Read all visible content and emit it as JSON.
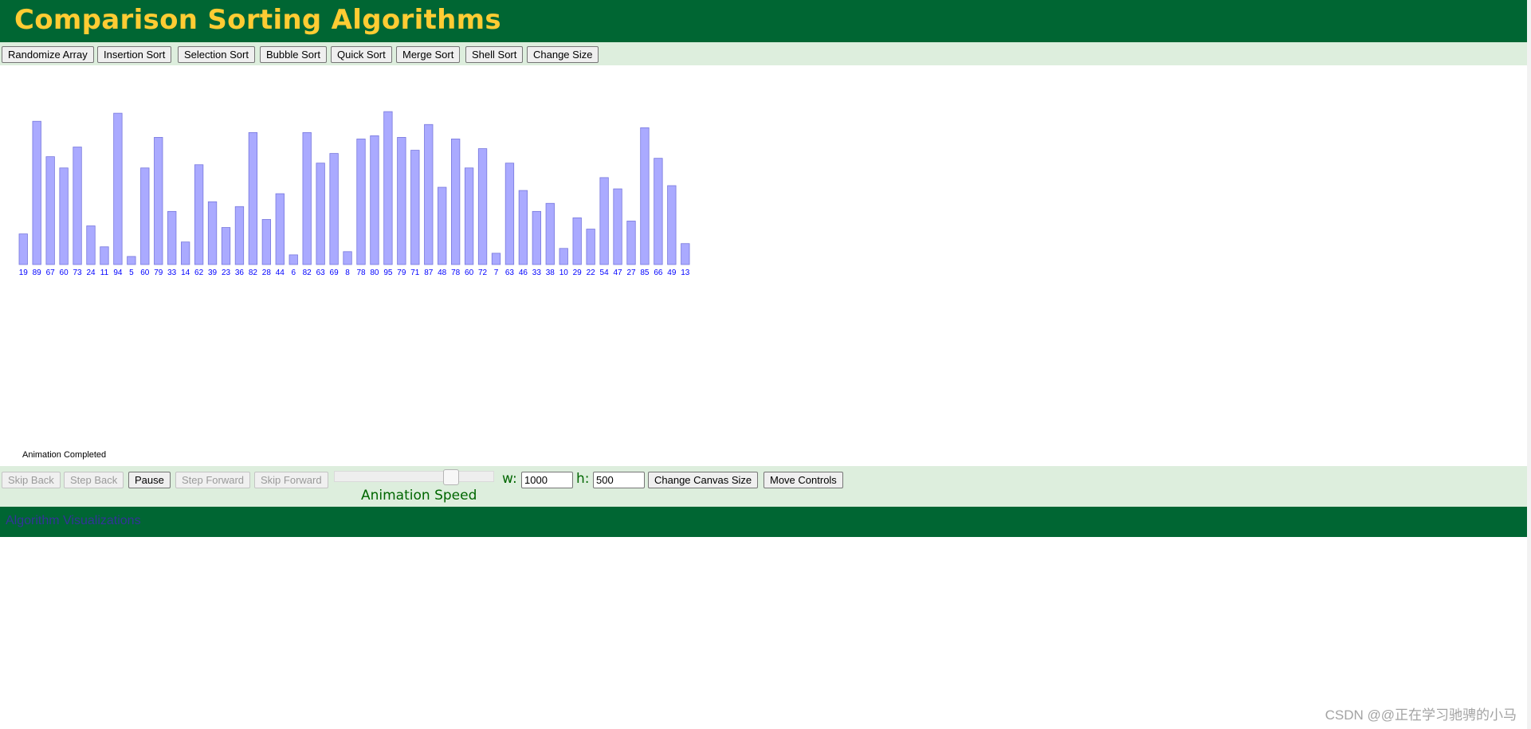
{
  "header": {
    "title": "Comparison Sorting Algorithms"
  },
  "top_controls": {
    "buttons": [
      "Randomize Array",
      "Insertion Sort",
      "Selection Sort",
      "Bubble Sort",
      "Quick Sort",
      "Merge Sort",
      "Shell Sort",
      "Change Size"
    ]
  },
  "chart_data": {
    "type": "bar",
    "values": [
      19,
      89,
      67,
      60,
      73,
      24,
      11,
      94,
      5,
      60,
      79,
      33,
      14,
      62,
      39,
      23,
      36,
      82,
      28,
      44,
      6,
      82,
      63,
      69,
      8,
      78,
      80,
      95,
      79,
      71,
      87,
      48,
      78,
      60,
      72,
      7,
      63,
      46,
      33,
      38,
      10,
      29,
      22,
      54,
      47,
      27,
      85,
      66,
      49,
      13
    ],
    "ylim": [
      0,
      100
    ],
    "bar_color": "#AAAAFF",
    "bar_border": "#7777DD",
    "label_color": "#0000FF"
  },
  "status": {
    "text": "Animation Completed"
  },
  "bottom_controls": {
    "skip_back": "Skip Back",
    "step_back": "Step Back",
    "pause": "Pause",
    "step_forward": "Step Forward",
    "skip_forward": "Skip Forward",
    "speed_label": "Animation Speed",
    "speed_value": 0.75,
    "w_label": "w:",
    "w_value": "1000",
    "h_label": "h:",
    "h_value": "500",
    "change_canvas": "Change Canvas Size",
    "move_controls": "Move Controls"
  },
  "footer": {
    "link": "Algorithm Visualizations"
  },
  "watermark": "CSDN @@正在学习驰骋的小马",
  "colors": {
    "header_bg": "#006633",
    "title": "#FFCC33",
    "controls_bg": "#DDEEDD",
    "speed_text": "#006600",
    "footer_link": "#333399"
  }
}
